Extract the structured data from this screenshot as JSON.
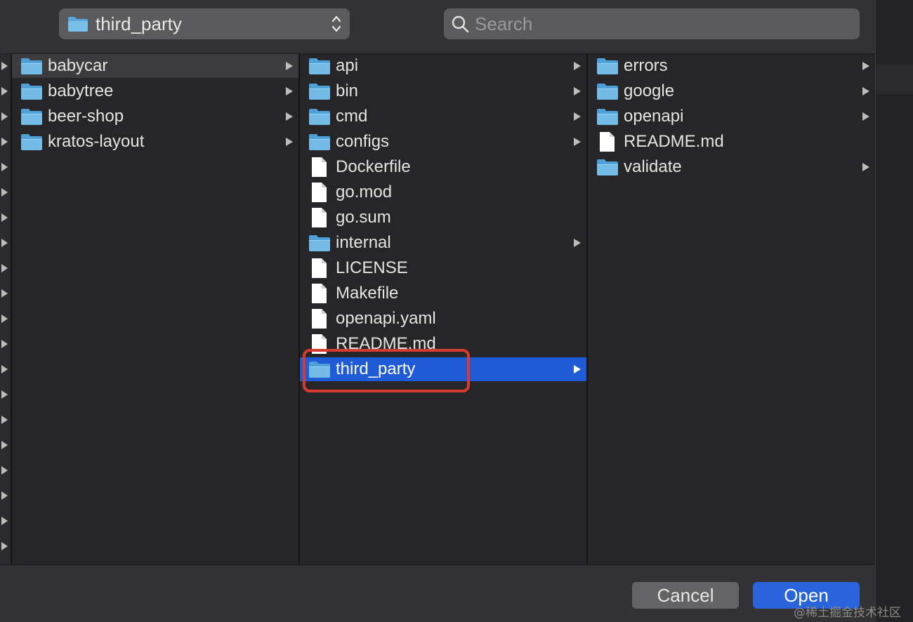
{
  "toolbar": {
    "path_popup_label": "third_party",
    "search_placeholder": "Search"
  },
  "columns": [
    {
      "items": [
        {
          "name": "babycar",
          "type": "folder",
          "has_children": true,
          "selected": "gray"
        },
        {
          "name": "babytree",
          "type": "folder",
          "has_children": true
        },
        {
          "name": "beer-shop",
          "type": "folder",
          "has_children": true
        },
        {
          "name": "kratos-layout",
          "type": "folder",
          "has_children": true
        }
      ]
    },
    {
      "items": [
        {
          "name": "api",
          "type": "folder",
          "has_children": true
        },
        {
          "name": "bin",
          "type": "folder",
          "has_children": true
        },
        {
          "name": "cmd",
          "type": "folder",
          "has_children": true
        },
        {
          "name": "configs",
          "type": "folder",
          "has_children": true
        },
        {
          "name": "Dockerfile",
          "type": "file"
        },
        {
          "name": "go.mod",
          "type": "file"
        },
        {
          "name": "go.sum",
          "type": "file"
        },
        {
          "name": "internal",
          "type": "folder",
          "has_children": true
        },
        {
          "name": "LICENSE",
          "type": "file"
        },
        {
          "name": "Makefile",
          "type": "file"
        },
        {
          "name": "openapi.yaml",
          "type": "file"
        },
        {
          "name": "README.md",
          "type": "file"
        },
        {
          "name": "third_party",
          "type": "folder",
          "has_children": true,
          "selected": "blue"
        }
      ]
    },
    {
      "items": [
        {
          "name": "errors",
          "type": "folder",
          "has_children": true
        },
        {
          "name": "google",
          "type": "folder",
          "has_children": true
        },
        {
          "name": "openapi",
          "type": "folder",
          "has_children": true
        },
        {
          "name": "README.md",
          "type": "file"
        },
        {
          "name": "validate",
          "type": "folder",
          "has_children": true
        }
      ]
    }
  ],
  "footer": {
    "cancel_label": "Cancel",
    "open_label": "Open"
  },
  "watermark": "@稀土掘金技术社区",
  "colors": {
    "selection_blue": "#1f5bd6",
    "open_button": "#2a64dc",
    "annotation_red": "#d93a2f",
    "folder_blue": "#6cb4e4"
  },
  "icons": {
    "folder": "folder-icon",
    "file": "file-icon",
    "search": "search-icon",
    "disclosure": "chevron-right-icon"
  }
}
